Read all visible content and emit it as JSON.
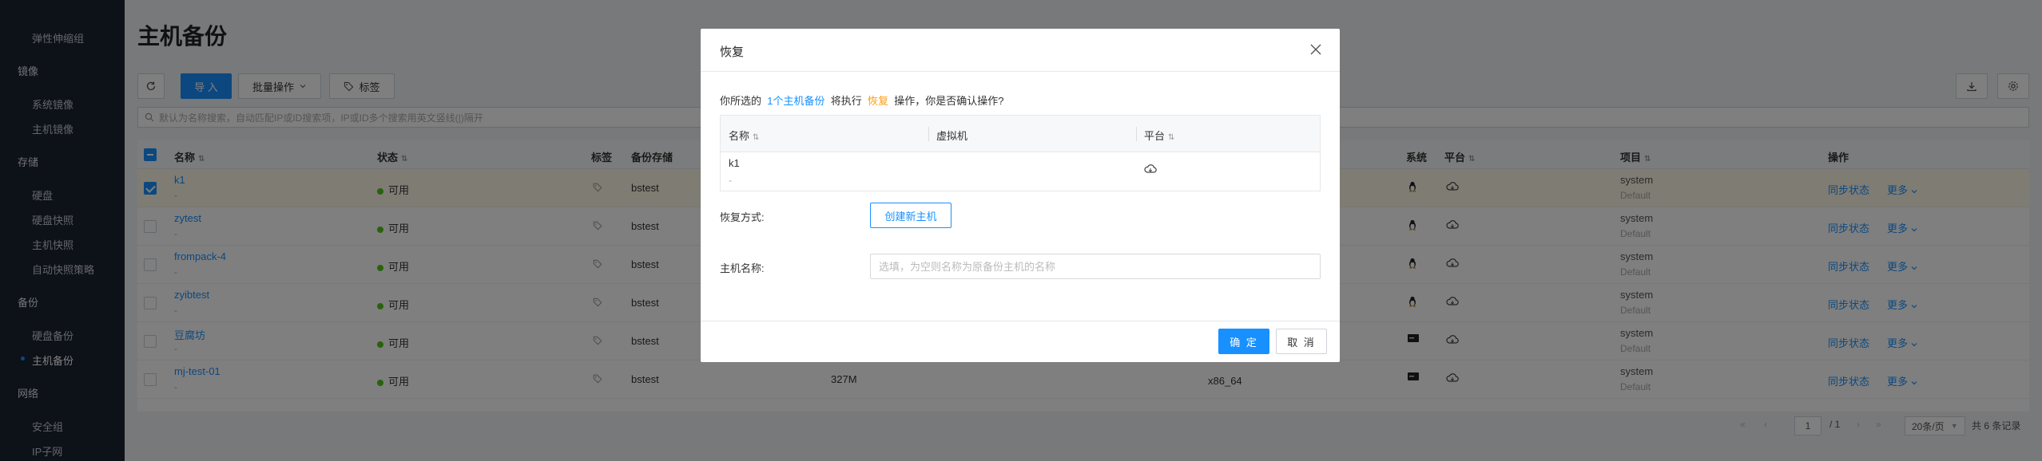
{
  "sidebar": {
    "items": [
      {
        "label": "弹性伸缩组",
        "type": "item"
      },
      {
        "label": "镜像",
        "type": "group"
      },
      {
        "label": "系统镜像",
        "type": "item"
      },
      {
        "label": "主机镜像",
        "type": "item"
      },
      {
        "label": "存储",
        "type": "group"
      },
      {
        "label": "硬盘",
        "type": "item"
      },
      {
        "label": "硬盘快照",
        "type": "item"
      },
      {
        "label": "主机快照",
        "type": "item"
      },
      {
        "label": "自动快照策略",
        "type": "item"
      },
      {
        "label": "备份",
        "type": "group"
      },
      {
        "label": "硬盘备份",
        "type": "item"
      },
      {
        "label": "主机备份",
        "type": "item",
        "active": true
      },
      {
        "label": "网络",
        "type": "group"
      },
      {
        "label": "安全组",
        "type": "item"
      },
      {
        "label": "IP子网",
        "type": "item"
      }
    ]
  },
  "page": {
    "title": "主机备份"
  },
  "toolbar": {
    "import_label": "导 入",
    "batch_label": "批量操作",
    "tag_label": "标签"
  },
  "search": {
    "placeholder": "默认为名称搜索，自动匹配IP或ID搜索项，IP或ID多个搜索用英文竖线(|)隔开"
  },
  "table": {
    "headers": {
      "name": "名称",
      "status": "状态",
      "tag": "标签",
      "storage": "备份存储",
      "system": "系统",
      "platform": "平台",
      "project": "项目",
      "actions": "操作"
    },
    "rows": [
      {
        "name": "k1",
        "sub": "-",
        "status": "可用",
        "storage": "bstest",
        "size": "",
        "arch": "",
        "os": "linux",
        "project": "system",
        "domain": "Default",
        "sync": "同步状态",
        "more": "更多",
        "selected": true
      },
      {
        "name": "zytest",
        "sub": "-",
        "status": "可用",
        "storage": "bstest",
        "size": "",
        "arch": "",
        "os": "linux",
        "project": "system",
        "domain": "Default",
        "sync": "同步状态",
        "more": "更多",
        "selected": false
      },
      {
        "name": "frompack-4",
        "sub": "-",
        "status": "可用",
        "storage": "bstest",
        "size": "",
        "arch": "",
        "os": "linux",
        "project": "system",
        "domain": "Default",
        "sync": "同步状态",
        "more": "更多",
        "selected": false
      },
      {
        "name": "zyibtest",
        "sub": "-",
        "status": "可用",
        "storage": "bstest",
        "size": "",
        "arch": "",
        "os": "linux",
        "project": "system",
        "domain": "Default",
        "sync": "同步状态",
        "more": "更多",
        "selected": false
      },
      {
        "name": "豆腐坊",
        "sub": "-",
        "status": "可用",
        "storage": "bstest",
        "size": "",
        "arch": "",
        "os": "terminal",
        "project": "system",
        "domain": "Default",
        "sync": "同步状态",
        "more": "更多",
        "selected": false
      },
      {
        "name": "mj-test-01",
        "sub": "-",
        "status": "可用",
        "storage": "bstest",
        "size": "327M",
        "arch": "x86_64",
        "os": "terminal",
        "project": "system",
        "domain": "Default",
        "sync": "同步状态",
        "more": "更多",
        "selected": false
      }
    ]
  },
  "pagination": {
    "current": "1",
    "total_pages": "/ 1",
    "page_size": "20条/页",
    "total_records": "共 6 条记录"
  },
  "modal": {
    "title": "恢复",
    "confirm_prefix": "你所选的",
    "confirm_target": "1个主机备份",
    "confirm_middle": "将执行",
    "confirm_action": "恢复",
    "confirm_suffix": "操作，你是否确认操作?",
    "table_headers": {
      "name": "名称",
      "vm": "虚拟机",
      "platform": "平台"
    },
    "table_row": {
      "name": "k1",
      "sub": "-"
    },
    "restore_mode_label": "恢复方式:",
    "restore_mode_button": "创建新主机",
    "host_name_label": "主机名称:",
    "host_name_placeholder": "选填，为空则名称为原备份主机的名称",
    "ok_label": "确 定",
    "cancel_label": "取 消"
  },
  "colors": {
    "primary": "#1890ff",
    "sidebar_bg": "#1b2230",
    "status_ok": "#52c41a",
    "highlight_orange": "#fa9d14"
  }
}
